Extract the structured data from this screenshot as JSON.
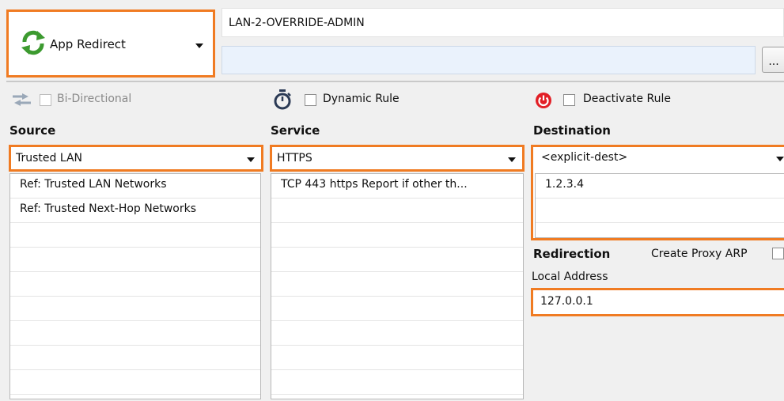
{
  "action": {
    "label": "App Redirect",
    "icon": "redirect-arrows-icon"
  },
  "rule": {
    "name": "LAN-2-OVERRIDE-ADMIN",
    "comment": "",
    "more_label": "..."
  },
  "options": {
    "bidirectional": {
      "label": "Bi-Directional",
      "checked": false,
      "enabled": false
    },
    "dynamic_rule": {
      "label": "Dynamic Rule",
      "checked": false
    },
    "deactivate_rule": {
      "label": "Deactivate Rule",
      "checked": false
    }
  },
  "source": {
    "title": "Source",
    "selected": "Trusted  LAN",
    "items": [
      "Ref: Trusted LAN Networks",
      "Ref: Trusted Next-Hop Networks"
    ]
  },
  "service": {
    "title": "Service",
    "selected": "HTTPS",
    "items": [
      "TCP  443 https  Report if other th..."
    ]
  },
  "destination": {
    "title": "Destination",
    "selected": "<explicit-dest>",
    "items": [
      "1.2.3.4"
    ]
  },
  "redirection": {
    "title": "Redirection",
    "proxy_arp_label": "Create Proxy ARP",
    "local_address_label": "Local Address",
    "local_address_value": "127.0.0.1"
  },
  "colors": {
    "highlight": "#f07b22",
    "green": "#3c9a2f",
    "red": "#e21f26"
  }
}
